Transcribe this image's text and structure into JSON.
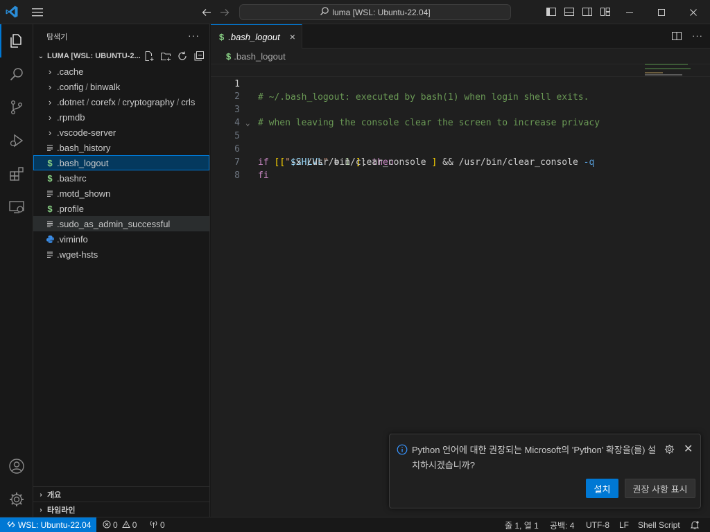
{
  "titlebar": {
    "search_text": "luma [WSL: Ubuntu-22.04]",
    "icons": [
      "vscode-logo",
      "menu-icon",
      "back-arrow-icon",
      "forward-arrow-icon",
      "search-icon",
      "toggle-sidebar-icon",
      "toggle-panel-icon",
      "toggle-secondary-sidebar-icon",
      "customize-layout-icon",
      "minimize-icon",
      "maximize-icon",
      "close-icon"
    ]
  },
  "activitybar": {
    "items": [
      "explorer",
      "search",
      "source-control",
      "run-and-debug",
      "extensions",
      "remote-explorer"
    ],
    "bottom": [
      "accounts",
      "manage"
    ]
  },
  "sidebar": {
    "title": "탐색기",
    "more": "···",
    "folder": "LUMA [WSL: UBUNTU-2...",
    "items": [
      {
        "label": ".cache",
        "type": "folder"
      },
      {
        "label": ".config",
        "type": "folder",
        "path": [
          "binwalk"
        ]
      },
      {
        "label": ".dotnet",
        "type": "folder",
        "path": [
          "corefx",
          "cryptography",
          "crls"
        ]
      },
      {
        "label": ".rpmdb",
        "type": "folder"
      },
      {
        "label": ".vscode-server",
        "type": "folder"
      },
      {
        "label": ".bash_history",
        "type": "file"
      },
      {
        "label": ".bash_logout",
        "type": "shell"
      },
      {
        "label": ".bashrc",
        "type": "shell"
      },
      {
        "label": ".motd_shown",
        "type": "file"
      },
      {
        "label": ".profile",
        "type": "shell"
      },
      {
        "label": ".sudo_as_admin_successful",
        "type": "file"
      },
      {
        "label": ".viminfo",
        "type": "python"
      },
      {
        "label": ".wget-hsts",
        "type": "file"
      }
    ],
    "outline": "개요",
    "timeline": "타임라인"
  },
  "editor": {
    "tab_label": ".bash_logout",
    "tab_close": "×",
    "breadcrumb": ".bash_logout",
    "dollar": "$",
    "line_numbers": [
      "1",
      "2",
      "3",
      "4",
      "5",
      "6",
      "7",
      "8"
    ],
    "lines": {
      "l1": "# ~/.bash_logout: executed by bash(1) when login shell exits.",
      "l3": "# when leaving the console clear the screen to increase privacy",
      "l5_if": "if",
      "l5_br1": "[",
      "l5_q1": "\"",
      "l5_var": "$SHLVL",
      "l5_q2": "\"",
      "l5_eq": "=",
      "l5_num": "1",
      "l5_br2": "]",
      "l5_semi": ";",
      "l5_then": "then",
      "l6_br1": "[",
      "l6_mid": "-x /usr/bin/clear_console",
      "l6_br2": "]",
      "l6_and": "&& /usr/bin/clear_console",
      "l6_flag": "-q",
      "l7": "fi"
    }
  },
  "notification": {
    "message": "Python 언어에 대한 권장되는 Microsoft의 'Python' 확장을(를) 설치하시겠습니까?",
    "install": "설치",
    "show_recommendations": "권장 사항 표시"
  },
  "statusbar": {
    "remote": "WSL: Ubuntu-22.04",
    "errors": "0",
    "warnings": "0",
    "ports": "0",
    "position": "줄 1, 열 1",
    "spaces": "공백: 4",
    "encoding": "UTF-8",
    "eol": "LF",
    "language": "Shell Script"
  },
  "colors": {
    "accent": "#0078d4",
    "comment": "#6a9955",
    "keyword": "#c586c0",
    "bracket": "#ffd700",
    "shell_icon": "#89d185",
    "python_icon": "#3b8eea"
  }
}
